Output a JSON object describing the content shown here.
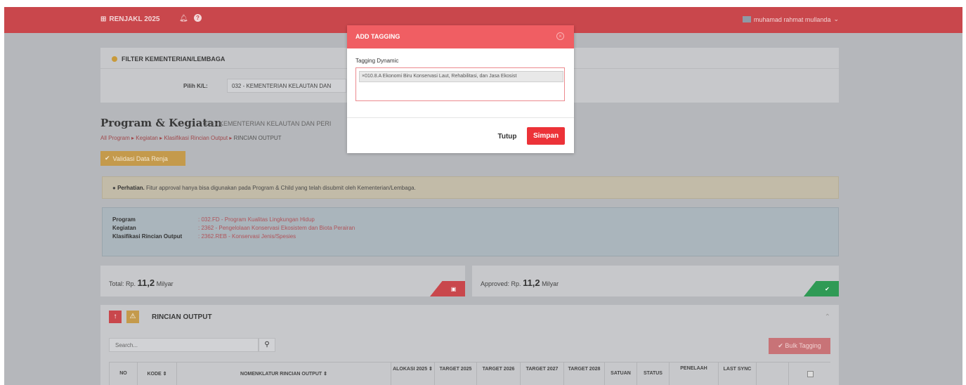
{
  "topbar": {
    "brand": "RENJAKL 2025",
    "user_name": "muhamad rahmat mullanda"
  },
  "filter": {
    "title": "FILTER KEMENTERIAN/LEMBAGA",
    "label": "Pilih K/L:",
    "selected": "032 - KEMENTERIAN KELAUTAN DAN"
  },
  "page": {
    "title": "Program & Kegiatan",
    "subtitle": "032 - KEMENTERIAN KELAUTAN DAN PERI",
    "breadcrumb": [
      "All Program",
      "Kegiatan",
      "Klasifikasi Rincian Output",
      "RINCIAN OUTPUT"
    ],
    "validate_button": "Validasi Data Renja"
  },
  "notice": {
    "bold": "Perhatian.",
    "text": "Fitur approval hanya bisa digunakan pada Program & Child yang telah disubmit oleh Kementerian/Lembaga."
  },
  "info": {
    "rows": [
      {
        "key": "Program",
        "value": ": 032.FD - Program Kualitas Lingkungan Hidup"
      },
      {
        "key": "Kegiatan",
        "value": ": 2362 - Pengelolaan Konservasi Ekosistem dan Biota Perairan"
      },
      {
        "key": "Klasifikasi Rincian Output",
        "value": ": 2362.REB - Konservasi Jenis/Spesies"
      }
    ]
  },
  "stats": {
    "total_prefix": "Total: Rp.",
    "total_value": "11,2",
    "total_unit": "Milyar",
    "approved_prefix": "Approved: Rp.",
    "approved_value": "11,2",
    "approved_unit": "Milyar"
  },
  "rincian": {
    "title": "RINCIAN OUTPUT",
    "search_placeholder": "Search...",
    "bulk_button": "Bulk Tagging",
    "columns": [
      "NO",
      "KODE ⇕",
      "NOMENKLATUR RINCIAN OUTPUT ⇕",
      "ALOKASI 2025 ⇕",
      "TARGET 2025",
      "TARGET 2026",
      "TARGET 2027",
      "TARGET 2028",
      "SATUAN",
      "STATUS",
      "PENELAAH",
      "LAST SYNC"
    ]
  },
  "modal": {
    "title": "ADD TAGGING",
    "field_label": "Tagging Dynamic",
    "tag": "×010.8.A Ekonomi Biru Konservasi Laut, Rehabilitasi, dan Jasa Ekosist",
    "cancel": "Tutup",
    "save": "Simpan"
  }
}
